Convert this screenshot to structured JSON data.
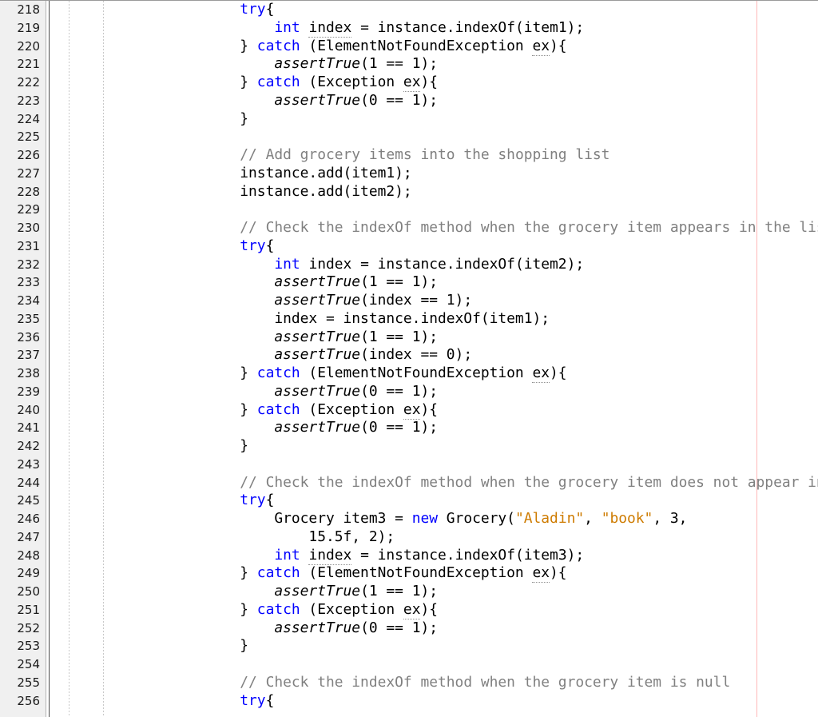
{
  "editor": {
    "language": "java",
    "first_line": 218,
    "last_line": 256,
    "colors": {
      "background": "#ffffff",
      "gutter_background": "#f0f0f0",
      "keyword": "#0000ff",
      "string": "#ce7b00",
      "comment": "#808080",
      "text": "#000000",
      "margin_line": "#ffb8b8",
      "indent_guide": "#c8c8c8",
      "gutter_separator": "#4a4a4a"
    }
  },
  "gutter": {
    "line_numbers": [
      "218",
      "219",
      "220",
      "221",
      "222",
      "223",
      "224",
      "225",
      "226",
      "227",
      "228",
      "229",
      "230",
      "231",
      "232",
      "233",
      "234",
      "235",
      "236",
      "237",
      "238",
      "239",
      "240",
      "241",
      "242",
      "243",
      "244",
      "245",
      "246",
      "247",
      "248",
      "249",
      "250",
      "251",
      "252",
      "253",
      "254",
      "255",
      "256"
    ]
  },
  "code": {
    "lines": [
      {
        "n": "218",
        "tokens": [
          {
            "t": "            ",
            "c": "plain"
          },
          {
            "t": "try",
            "c": "kw"
          },
          {
            "t": "{",
            "c": "plain"
          }
        ]
      },
      {
        "n": "219",
        "tokens": [
          {
            "t": "                ",
            "c": "plain"
          },
          {
            "t": "int",
            "c": "kw"
          },
          {
            "t": " ",
            "c": "plain"
          },
          {
            "t": "index",
            "c": "warn"
          },
          {
            "t": " = instance.indexOf(item1);",
            "c": "plain"
          }
        ]
      },
      {
        "n": "220",
        "tokens": [
          {
            "t": "            } ",
            "c": "plain"
          },
          {
            "t": "catch",
            "c": "kw"
          },
          {
            "t": " (ElementNotFoundException ",
            "c": "plain"
          },
          {
            "t": "ex",
            "c": "warn"
          },
          {
            "t": "){",
            "c": "plain"
          }
        ]
      },
      {
        "n": "221",
        "tokens": [
          {
            "t": "                ",
            "c": "plain"
          },
          {
            "t": "assertTrue",
            "c": "assert"
          },
          {
            "t": "(1 == 1);",
            "c": "plain"
          }
        ]
      },
      {
        "n": "222",
        "tokens": [
          {
            "t": "            } ",
            "c": "plain"
          },
          {
            "t": "catch",
            "c": "kw"
          },
          {
            "t": " (Exception ",
            "c": "plain"
          },
          {
            "t": "ex",
            "c": "warn"
          },
          {
            "t": "){",
            "c": "plain"
          }
        ]
      },
      {
        "n": "223",
        "tokens": [
          {
            "t": "                ",
            "c": "plain"
          },
          {
            "t": "assertTrue",
            "c": "assert"
          },
          {
            "t": "(0 == 1);",
            "c": "plain"
          }
        ]
      },
      {
        "n": "224",
        "tokens": [
          {
            "t": "            }",
            "c": "plain"
          }
        ]
      },
      {
        "n": "225",
        "tokens": []
      },
      {
        "n": "226",
        "tokens": [
          {
            "t": "            ",
            "c": "plain"
          },
          {
            "t": "// Add grocery items into the shopping list",
            "c": "cmt"
          }
        ]
      },
      {
        "n": "227",
        "tokens": [
          {
            "t": "            instance.add(item1);",
            "c": "plain"
          }
        ]
      },
      {
        "n": "228",
        "tokens": [
          {
            "t": "            instance.add(item2);",
            "c": "plain"
          }
        ]
      },
      {
        "n": "229",
        "tokens": []
      },
      {
        "n": "230",
        "tokens": [
          {
            "t": "            ",
            "c": "plain"
          },
          {
            "t": "// Check the indexOf method when the grocery item appears in the list",
            "c": "cmt"
          }
        ]
      },
      {
        "n": "231",
        "tokens": [
          {
            "t": "            ",
            "c": "plain"
          },
          {
            "t": "try",
            "c": "kw"
          },
          {
            "t": "{",
            "c": "plain"
          }
        ]
      },
      {
        "n": "232",
        "tokens": [
          {
            "t": "                ",
            "c": "plain"
          },
          {
            "t": "int",
            "c": "kw"
          },
          {
            "t": " index = instance.indexOf(item2);",
            "c": "plain"
          }
        ]
      },
      {
        "n": "233",
        "tokens": [
          {
            "t": "                ",
            "c": "plain"
          },
          {
            "t": "assertTrue",
            "c": "assert"
          },
          {
            "t": "(1 == 1);",
            "c": "plain"
          }
        ]
      },
      {
        "n": "234",
        "tokens": [
          {
            "t": "                ",
            "c": "plain"
          },
          {
            "t": "assertTrue",
            "c": "assert"
          },
          {
            "t": "(index == 1);",
            "c": "plain"
          }
        ]
      },
      {
        "n": "235",
        "tokens": [
          {
            "t": "                index = instance.indexOf(item1);",
            "c": "plain"
          }
        ]
      },
      {
        "n": "236",
        "tokens": [
          {
            "t": "                ",
            "c": "plain"
          },
          {
            "t": "assertTrue",
            "c": "assert"
          },
          {
            "t": "(1 == 1);",
            "c": "plain"
          }
        ]
      },
      {
        "n": "237",
        "tokens": [
          {
            "t": "                ",
            "c": "plain"
          },
          {
            "t": "assertTrue",
            "c": "assert"
          },
          {
            "t": "(index == 0);",
            "c": "plain"
          }
        ]
      },
      {
        "n": "238",
        "tokens": [
          {
            "t": "            } ",
            "c": "plain"
          },
          {
            "t": "catch",
            "c": "kw"
          },
          {
            "t": " (ElementNotFoundException ",
            "c": "plain"
          },
          {
            "t": "ex",
            "c": "warn"
          },
          {
            "t": "){",
            "c": "plain"
          }
        ]
      },
      {
        "n": "239",
        "tokens": [
          {
            "t": "                ",
            "c": "plain"
          },
          {
            "t": "assertTrue",
            "c": "assert"
          },
          {
            "t": "(0 == 1);",
            "c": "plain"
          }
        ]
      },
      {
        "n": "240",
        "tokens": [
          {
            "t": "            } ",
            "c": "plain"
          },
          {
            "t": "catch",
            "c": "kw"
          },
          {
            "t": " (Exception ",
            "c": "plain"
          },
          {
            "t": "ex",
            "c": "warn"
          },
          {
            "t": "){",
            "c": "plain"
          }
        ]
      },
      {
        "n": "241",
        "tokens": [
          {
            "t": "                ",
            "c": "plain"
          },
          {
            "t": "assertTrue",
            "c": "assert"
          },
          {
            "t": "(0 == 1);",
            "c": "plain"
          }
        ]
      },
      {
        "n": "242",
        "tokens": [
          {
            "t": "            }",
            "c": "plain"
          }
        ]
      },
      {
        "n": "243",
        "tokens": []
      },
      {
        "n": "244",
        "tokens": [
          {
            "t": "            ",
            "c": "plain"
          },
          {
            "t": "// Check the indexOf method when the grocery item does not appear in the list",
            "c": "cmt"
          }
        ]
      },
      {
        "n": "245",
        "tokens": [
          {
            "t": "            ",
            "c": "plain"
          },
          {
            "t": "try",
            "c": "kw"
          },
          {
            "t": "{",
            "c": "plain"
          }
        ]
      },
      {
        "n": "246",
        "tokens": [
          {
            "t": "                Grocery item3 = ",
            "c": "plain"
          },
          {
            "t": "new",
            "c": "kw"
          },
          {
            "t": " Grocery(",
            "c": "plain"
          },
          {
            "t": "\"Aladin\"",
            "c": "str"
          },
          {
            "t": ", ",
            "c": "plain"
          },
          {
            "t": "\"book\"",
            "c": "str"
          },
          {
            "t": ", 3,",
            "c": "plain"
          }
        ]
      },
      {
        "n": "247",
        "tokens": [
          {
            "t": "                    15.5f, 2);",
            "c": "plain"
          }
        ]
      },
      {
        "n": "248",
        "tokens": [
          {
            "t": "                ",
            "c": "plain"
          },
          {
            "t": "int",
            "c": "kw"
          },
          {
            "t": " ",
            "c": "plain"
          },
          {
            "t": "index",
            "c": "warn"
          },
          {
            "t": " = instance.indexOf(item3);",
            "c": "plain"
          }
        ]
      },
      {
        "n": "249",
        "tokens": [
          {
            "t": "            } ",
            "c": "plain"
          },
          {
            "t": "catch",
            "c": "kw"
          },
          {
            "t": " (ElementNotFoundException ",
            "c": "plain"
          },
          {
            "t": "ex",
            "c": "warn"
          },
          {
            "t": "){",
            "c": "plain"
          }
        ]
      },
      {
        "n": "250",
        "tokens": [
          {
            "t": "                ",
            "c": "plain"
          },
          {
            "t": "assertTrue",
            "c": "assert"
          },
          {
            "t": "(1 == 1);",
            "c": "plain"
          }
        ]
      },
      {
        "n": "251",
        "tokens": [
          {
            "t": "            } ",
            "c": "plain"
          },
          {
            "t": "catch",
            "c": "kw"
          },
          {
            "t": " (Exception ",
            "c": "plain"
          },
          {
            "t": "ex",
            "c": "warn"
          },
          {
            "t": "){",
            "c": "plain"
          }
        ]
      },
      {
        "n": "252",
        "tokens": [
          {
            "t": "                ",
            "c": "plain"
          },
          {
            "t": "assertTrue",
            "c": "assert"
          },
          {
            "t": "(0 == 1);",
            "c": "plain"
          }
        ]
      },
      {
        "n": "253",
        "tokens": [
          {
            "t": "            }",
            "c": "plain"
          }
        ]
      },
      {
        "n": "254",
        "tokens": []
      },
      {
        "n": "255",
        "tokens": [
          {
            "t": "            ",
            "c": "plain"
          },
          {
            "t": "// Check the indexOf method when the grocery item is null",
            "c": "cmt"
          }
        ]
      },
      {
        "n": "256",
        "tokens": [
          {
            "t": "            ",
            "c": "plain"
          },
          {
            "t": "try",
            "c": "kw"
          },
          {
            "t": "{",
            "c": "plain"
          }
        ]
      }
    ]
  }
}
